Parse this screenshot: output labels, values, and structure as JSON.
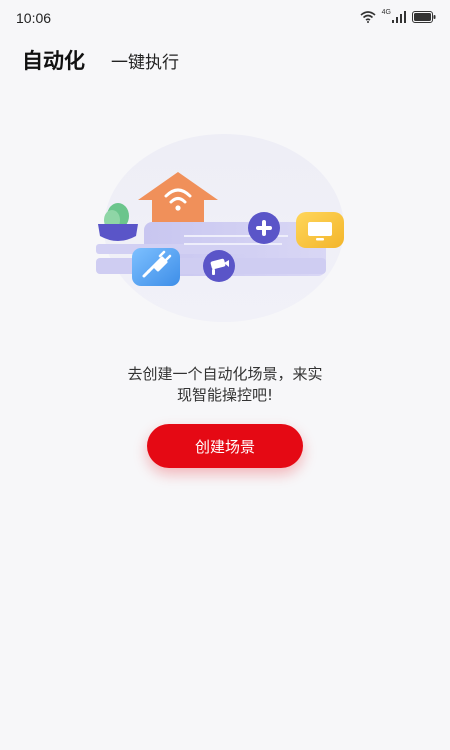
{
  "status_bar": {
    "time": "10:06",
    "network_label": "4G"
  },
  "tabs": [
    {
      "label": "自动化",
      "active": true
    },
    {
      "label": "一键执行",
      "active": false
    }
  ],
  "empty_state": {
    "message_line1": "去创建一个自动化场景，来实",
    "message_line2": "现智能操控吧!",
    "button_label": "创建场景"
  },
  "icons": [
    "wifi-icon",
    "signal-icon",
    "battery-icon",
    "house-wifi-icon",
    "plus-icon",
    "tv-icon",
    "plug-icon",
    "camera-icon",
    "plant-icon"
  ],
  "colors": {
    "accent": "#e50914",
    "background": "#f7f7f9",
    "house": "#f0905a",
    "plug": "#4a9ef0",
    "tv": "#f7c23c",
    "purple": "#5a55c8"
  }
}
